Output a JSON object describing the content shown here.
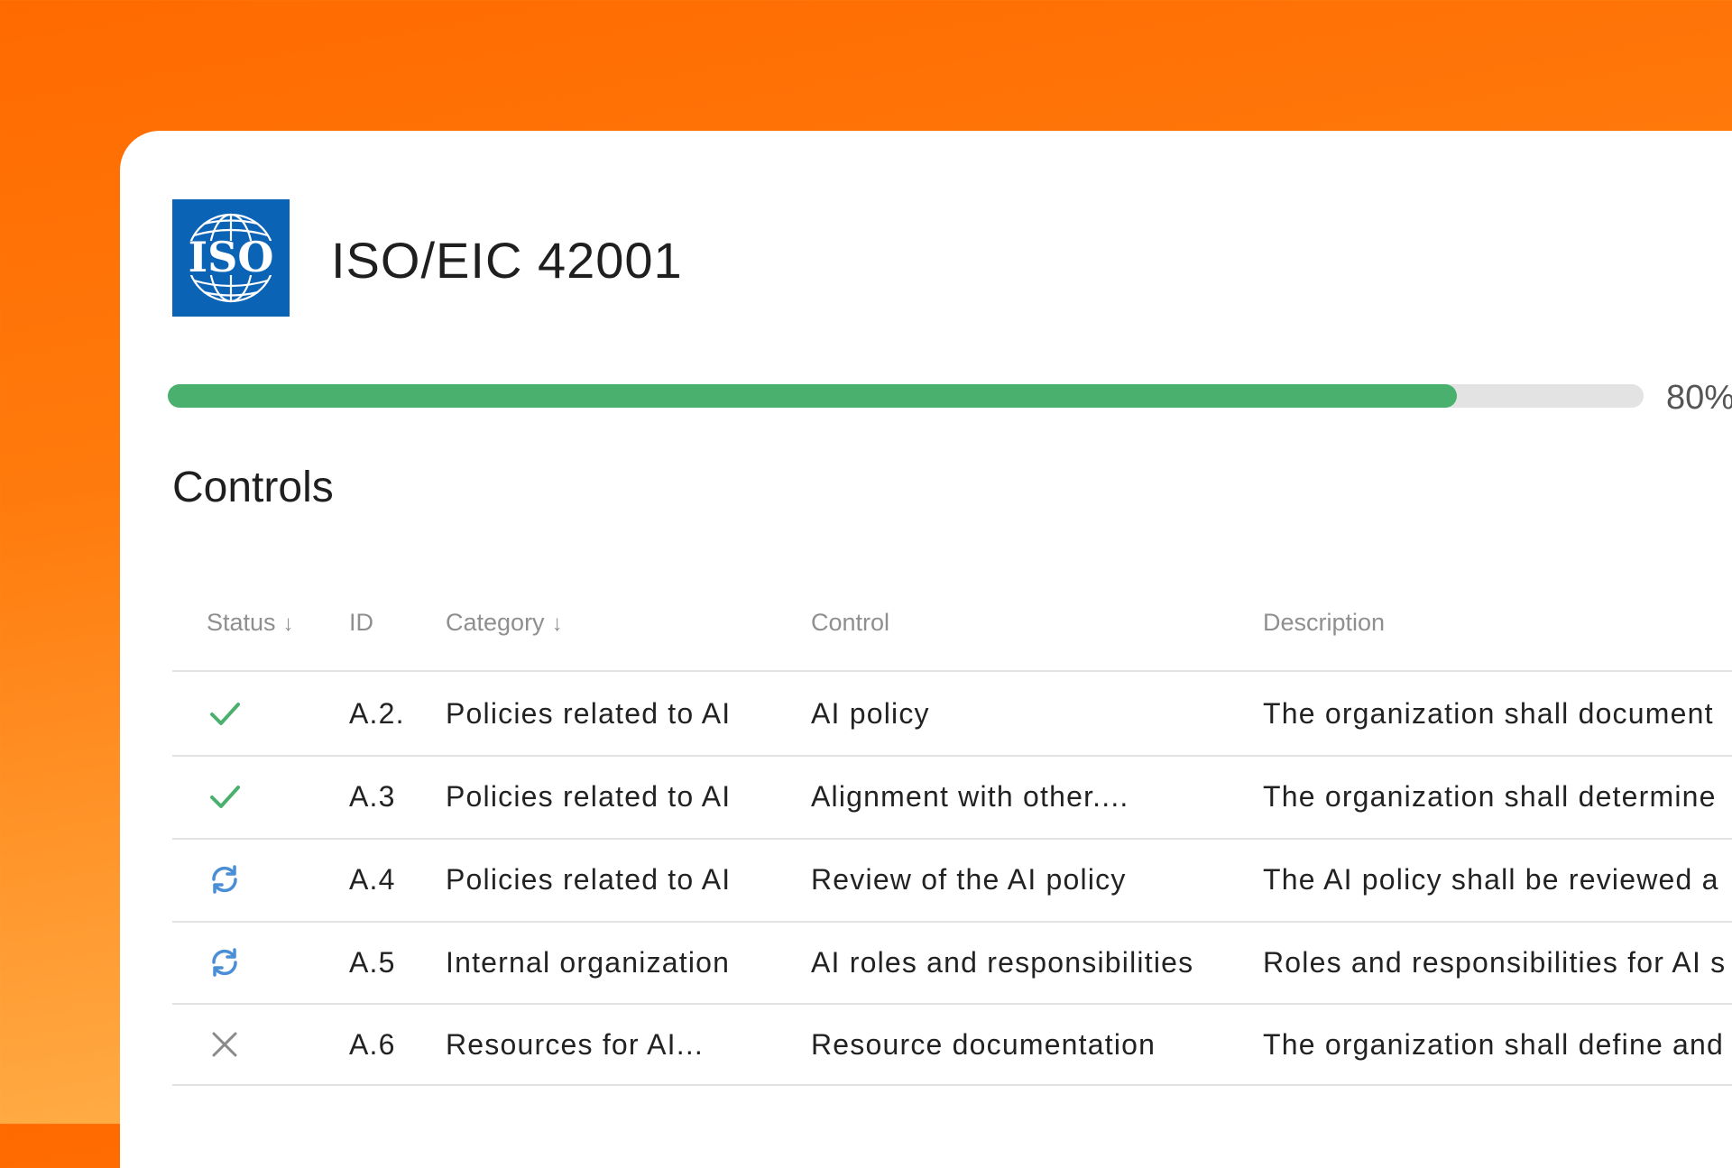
{
  "header": {
    "logo_text": "ISO",
    "title": "ISO/EIC 42001"
  },
  "progress": {
    "value_percent": 80,
    "label": "80%"
  },
  "section": {
    "heading": "Controls"
  },
  "table": {
    "columns": {
      "status": "Status",
      "id": "ID",
      "category": "Category",
      "control": "Control",
      "description": "Description"
    },
    "sort_arrow": "↓",
    "rows": [
      {
        "status": "check-icon",
        "id": "A.2.",
        "category": "Policies related to AI",
        "control": "AI policy",
        "description": "The organization shall document"
      },
      {
        "status": "check-icon",
        "id": "A.3",
        "category": "Policies related to AI",
        "control": "Alignment with other....",
        "description": "The organization shall determine"
      },
      {
        "status": "sync-icon",
        "id": "A.4",
        "category": "Policies related to AI",
        "control": "Review of the AI policy",
        "description": "The AI policy shall be reviewed a"
      },
      {
        "status": "sync-icon",
        "id": "A.5",
        "category": "Internal organization",
        "control": "AI roles and responsibilities",
        "description": "Roles and responsibilities for AI s"
      },
      {
        "status": "close-icon",
        "id": "A.6",
        "category": "Resources for AI...",
        "control": "Resource documentation",
        "description": "The organization shall define and"
      }
    ]
  },
  "colors": {
    "background_top": "#ff6a00",
    "background_bottom": "#ffc25e",
    "logo_blue": "#0b63b6",
    "progress_green": "#4ab06d",
    "check_green": "#4ab06d",
    "sync_blue": "#4a8fd6",
    "cross_gray": "#8a8a8a"
  }
}
